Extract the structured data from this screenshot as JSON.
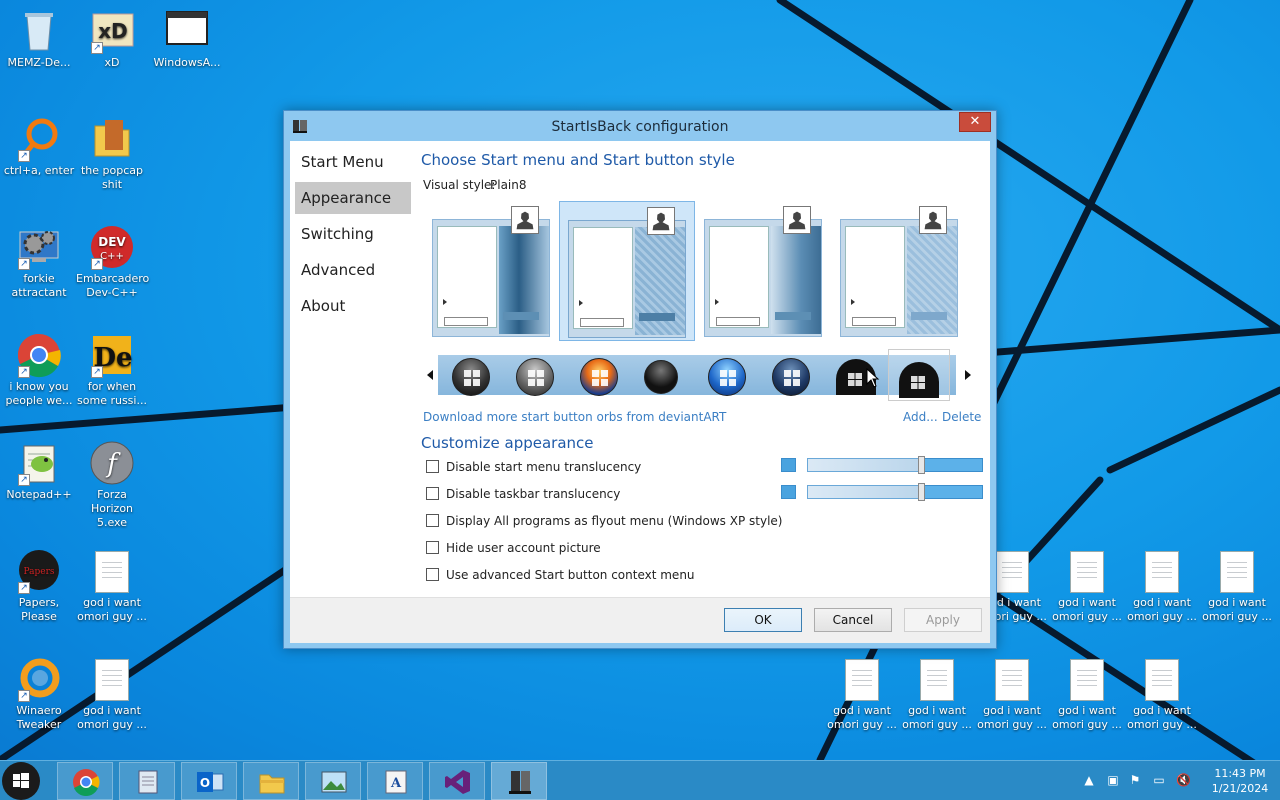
{
  "desktop": {
    "icons": [
      {
        "label": "MEMZ-De...",
        "icon": "recycle-bin-icon"
      },
      {
        "label": "xD",
        "icon": "hxd-icon"
      },
      {
        "label": "WindowsA...",
        "icon": "window-icon"
      },
      {
        "label": "ctrl+a, enter",
        "icon": "magnifier-icon"
      },
      {
        "label": "the popcap shit",
        "icon": "folder-icon"
      },
      {
        "label": "forkie attractant",
        "icon": "control-panel-icon"
      },
      {
        "label": "Embarcadero Dev-C++",
        "icon": "devcpp-icon"
      },
      {
        "label": "i know you people we...",
        "icon": "chrome-icon"
      },
      {
        "label": "for when some russi...",
        "icon": "dependency-walker-icon"
      },
      {
        "label": "Notepad++",
        "icon": "notepadpp-icon"
      },
      {
        "label": "Forza Horizon 5.exe",
        "icon": "flash-icon"
      },
      {
        "label": "Papers, Please",
        "icon": "papers-please-icon"
      },
      {
        "label": "god i want omori guy ...",
        "icon": "text-file-icon"
      },
      {
        "label": "Winaero Tweaker",
        "icon": "winaero-icon"
      },
      {
        "label": "god i want omori guy ...",
        "icon": "text-file-icon"
      }
    ],
    "files": "god i want omori guy ..."
  },
  "window": {
    "title": "StartIsBack configuration",
    "close": "✕",
    "nav": [
      "Start Menu",
      "Appearance",
      "Switching",
      "Advanced",
      "About"
    ],
    "selected_nav": "Appearance",
    "heading": "Choose Start menu and Start button style",
    "visual_style_label": "Visual style:",
    "visual_style_value": "Plain8",
    "download_link": "Download more start button orbs from deviantART",
    "add_link": "Add...",
    "delete_link": "Delete",
    "customize_heading": "Customize appearance",
    "options": [
      {
        "label": "Disable start menu translucency",
        "checked": false
      },
      {
        "label": "Disable taskbar translucency",
        "checked": false
      },
      {
        "label": "Display All programs as flyout menu (Windows XP style)",
        "checked": false
      },
      {
        "label": "Hide user account picture",
        "checked": false
      },
      {
        "label": "Use advanced Start button context menu",
        "checked": false
      }
    ],
    "buttons": {
      "ok": "OK",
      "cancel": "Cancel",
      "apply": "Apply"
    }
  },
  "taskbar": {
    "apps": [
      "chrome-icon",
      "notepad-icon",
      "outlook-icon",
      "explorer-icon",
      "photos-icon",
      "wordpad-icon",
      "visual-studio-icon",
      "startisback-icon"
    ],
    "time": "11:43 PM",
    "date": "1/21/2024"
  },
  "colors": {
    "accent": "#1f5aa8",
    "selected_nav": "#c8c8c8",
    "close": "#c94c3c",
    "taskbar": "#2a8ac6"
  }
}
